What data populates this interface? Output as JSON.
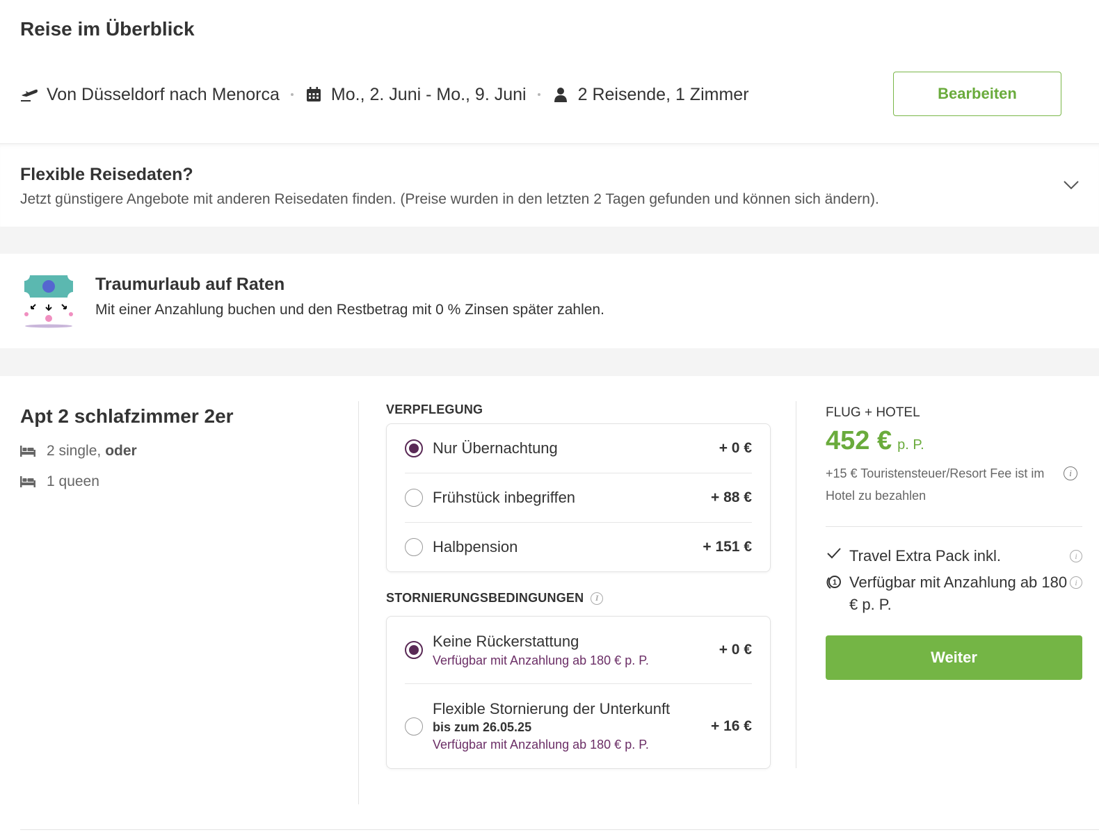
{
  "overview": {
    "title": "Reise im Überblick",
    "route": "Von Düsseldorf nach Menorca",
    "dates": "Mo., 2. Juni - Mo., 9. Juni",
    "travelers": "2 Reisende, 1 Zimmer",
    "edit_label": "Bearbeiten"
  },
  "flexible": {
    "title": "Flexible Reisedaten?",
    "text": "Jetzt günstigere Angebote mit anderen Reisedaten finden. (Preise wurden in den letzten 2 Tagen gefunden und können sich ändern)."
  },
  "installments": {
    "title": "Traumurlaub auf Raten",
    "text": "Mit einer Anzahlung buchen und den Restbetrag mit 0 % Zinsen später zahlen."
  },
  "room": {
    "title": "Apt 2 schlafzimmer 2er",
    "bed1": "2 single,",
    "bed1_or": "oder",
    "bed2": "1 queen"
  },
  "meals": {
    "label": "Verpflegung",
    "options": [
      {
        "label": "Nur Übernachtung",
        "price": "+ 0 €",
        "selected": true
      },
      {
        "label": "Frühstück inbegriffen",
        "price": "+ 88 €",
        "selected": false
      },
      {
        "label": "Halbpension",
        "price": "+ 151 €",
        "selected": false
      }
    ]
  },
  "cancellation": {
    "label": "Stornierungsbedingungen",
    "options": [
      {
        "label": "Keine Rückerstattung",
        "note": "Verfügbar mit Anzahlung ab 180 € p. P.",
        "price": "+ 0 €",
        "selected": true
      },
      {
        "label": "Flexible Stornierung der Unterkunft",
        "date": "bis zum 26.05.25",
        "note": "Verfügbar mit Anzahlung ab 180 € p. P.",
        "price": "+ 16 €",
        "selected": false
      }
    ]
  },
  "pricing": {
    "header": "FLUG + HOTEL",
    "amount": "452 €",
    "per_person": "p. P.",
    "tax_note": "+15 € Touristensteuer/Resort Fee ist im Hotel zu bezahlen",
    "feature1": "Travel Extra Pack inkl.",
    "feature2": "Verfügbar mit Anzahlung ab 180 € p. P.",
    "next_label": "Weiter"
  },
  "colors": {
    "accent_green": "#74b545",
    "radio_purple": "#5a2a56",
    "note_purple": "#6b2e66"
  }
}
